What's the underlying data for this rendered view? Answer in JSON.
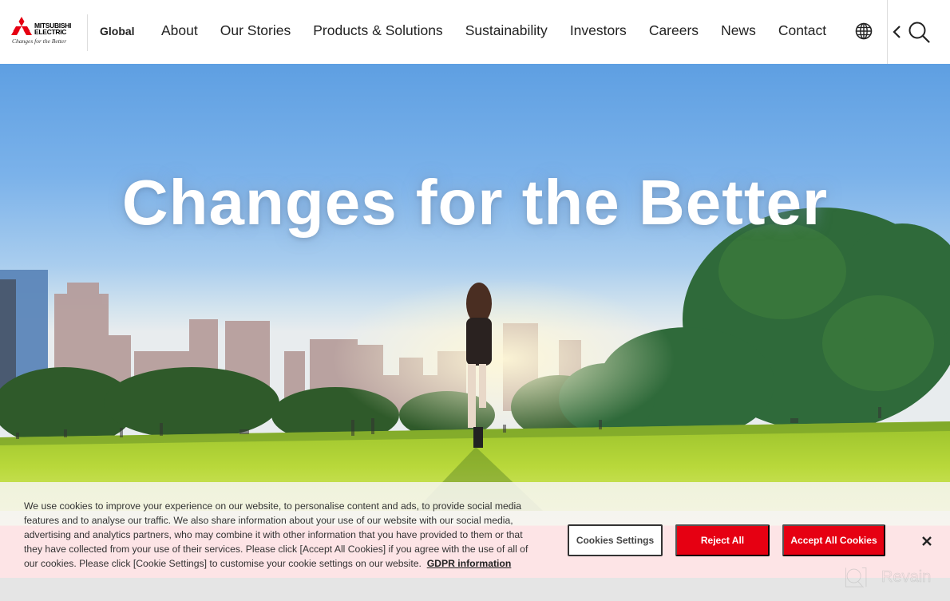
{
  "header": {
    "logo": {
      "brand_line1": "MITSUBISHI",
      "brand_line2": "ELECTRIC",
      "tagline": "Changes for the Better",
      "brand_color": "#e60012"
    },
    "region_label": "Global",
    "nav": [
      {
        "label": "About"
      },
      {
        "label": "Our Stories"
      },
      {
        "label": "Products & Solutions"
      },
      {
        "label": "Sustainability"
      },
      {
        "label": "Investors"
      },
      {
        "label": "Careers"
      },
      {
        "label": "News"
      },
      {
        "label": "Contact"
      }
    ],
    "icons": {
      "language": "globe-icon",
      "expand": "chevron-left-icon",
      "search": "search-icon"
    }
  },
  "hero": {
    "title": "Changes for the Better"
  },
  "cookie_banner": {
    "text": "We use cookies to improve your experience on our website, to personalise content and ads, to provide social media features and to analyse our traffic. We also share information about your use of our website with our social media, advertising and analytics partners, who may combine it with other information that you have provided to them or that they have collected from your use of their services. Please click [Accept All Cookies] if you agree with the use of all of our cookies. Please click [Cookie Settings] to customise your cookie settings on our website.",
    "link_label": "GDPR information",
    "buttons": {
      "settings": "Cookies Settings",
      "reject": "Reject All",
      "accept": "Accept All Cookies"
    },
    "accent_color": "#e60012",
    "close_icon": "close-icon"
  },
  "watermark": {
    "label": "Revain"
  }
}
